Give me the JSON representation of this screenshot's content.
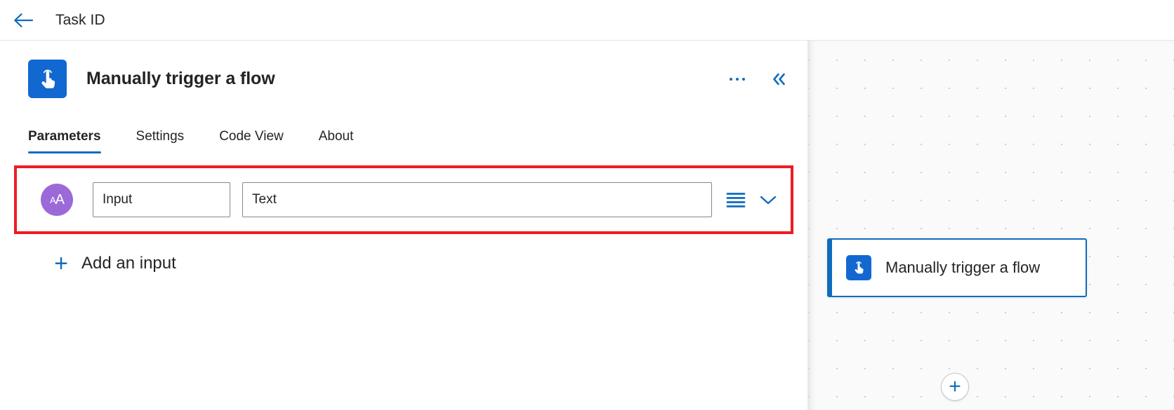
{
  "topbar": {
    "back_icon": "arrow-left-icon",
    "title": "Task ID"
  },
  "detail": {
    "node_icon": "tap-hand-icon",
    "node_title": "Manually trigger a flow",
    "more_actions_label": "•••",
    "collapse_label": "«",
    "tabs": [
      {
        "label": "Parameters",
        "active": true
      },
      {
        "label": "Settings",
        "active": false
      },
      {
        "label": "Code View",
        "active": false
      },
      {
        "label": "About",
        "active": false
      }
    ],
    "parameter_row": {
      "type_icon": "text-type-icon",
      "type_icon_small": "A",
      "type_icon_large": "A",
      "name_value": "Input",
      "name_placeholder": "Input",
      "value_value": "Text",
      "value_placeholder": "Text",
      "list_icon": "list-lines-icon",
      "chevron_icon": "chevron-down-icon",
      "highlight_color": "#ed1c24"
    },
    "add_input": {
      "plus": "+",
      "label": "Add an input"
    }
  },
  "canvas": {
    "node": {
      "icon": "tap-hand-icon",
      "title": "Manually trigger a flow",
      "accent_color": "#0f6cbd"
    },
    "add_step": {
      "plus": "+"
    }
  }
}
